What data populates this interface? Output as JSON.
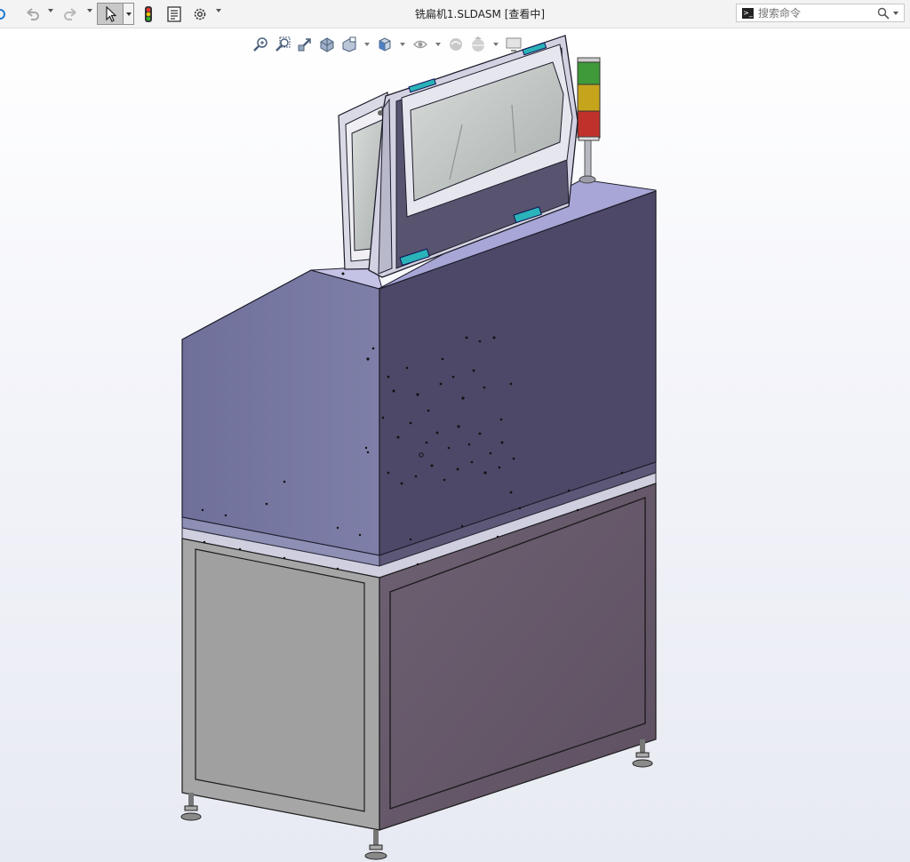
{
  "window": {
    "title": "铣扁机1.SLDASM [查看中]"
  },
  "toolbar": {
    "items": [
      {
        "name": "rebuild-icon"
      },
      {
        "name": "undo-icon"
      },
      {
        "name": "redo-icon"
      },
      {
        "name": "select-arrow-icon"
      },
      {
        "name": "traffic-light-icon"
      },
      {
        "name": "file-properties-icon"
      },
      {
        "name": "options-gear-icon"
      }
    ]
  },
  "search": {
    "placeholder": "搜索命令",
    "value": ""
  },
  "heads_up": {
    "items": [
      {
        "name": "zoom-to-fit-icon"
      },
      {
        "name": "zoom-to-area-icon"
      },
      {
        "name": "previous-view-icon"
      },
      {
        "name": "section-view-icon"
      },
      {
        "name": "dynamic-annotation-icon"
      },
      {
        "name": "view-orientation-icon"
      },
      {
        "name": "display-style-icon"
      },
      {
        "name": "hide-show-items-icon"
      },
      {
        "name": "edit-appearance-icon"
      },
      {
        "name": "apply-scene-icon"
      },
      {
        "name": "view-settings-icon"
      }
    ]
  },
  "colors": {
    "cabinet_front": "#4d4868",
    "cabinet_side": "#77789e",
    "cabinet_top": "#a7a6d6",
    "base_front": "#6b5d6c",
    "base_side": "#a4a4a4",
    "light_red": "#c0312b",
    "light_yellow": "#c6a51d",
    "light_green": "#3f9b3a",
    "hinge_teal": "#2ab3b8"
  }
}
